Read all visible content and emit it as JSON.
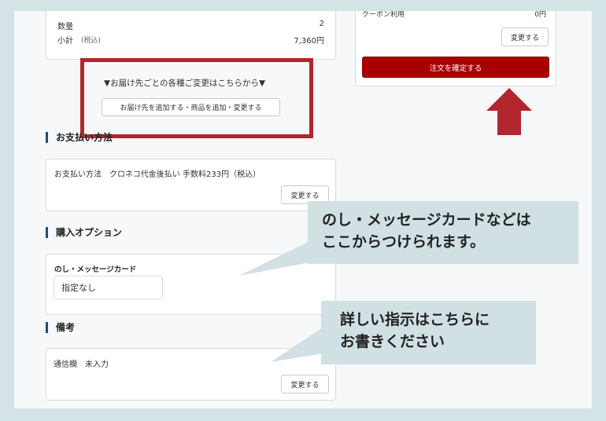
{
  "summary": {
    "quantity_label": "数量",
    "quantity_value": "2",
    "subtotal_label": "小計",
    "subtotal_tax": "(税込)",
    "subtotal_value": "7,360円"
  },
  "delivery": {
    "notice": "▼お届け先ごとの各種ご変更はこちらから▼",
    "button": "お届け先を追加する・商品を追加・変更する"
  },
  "payment": {
    "title": "お支払い方法",
    "text": "お支払い方法　クロネコ代金後払い 手数料233円（税込）",
    "change": "変更する"
  },
  "options": {
    "title": "購入オプション",
    "label": "のし・メッセージカード",
    "value": "指定なし"
  },
  "remarks": {
    "title": "備考",
    "text": "通信欄　未入力",
    "change": "変更する"
  },
  "right": {
    "coupon_label": "クーポン利用",
    "coupon_value": "0円",
    "change": "変更する",
    "confirm": "注文を確定する"
  },
  "callouts": {
    "noshi_line1": "のし・メッセージカードなどは",
    "noshi_line2": "ここからつけられます。",
    "remarks_line1": "詳しい指示はこちらに",
    "remarks_line2": "お書きください"
  },
  "colors": {
    "accent_red": "#b3262d",
    "confirm_red": "#a80000",
    "section_bar": "#1d4a8a",
    "callout_bg": "#d1e0e3"
  }
}
